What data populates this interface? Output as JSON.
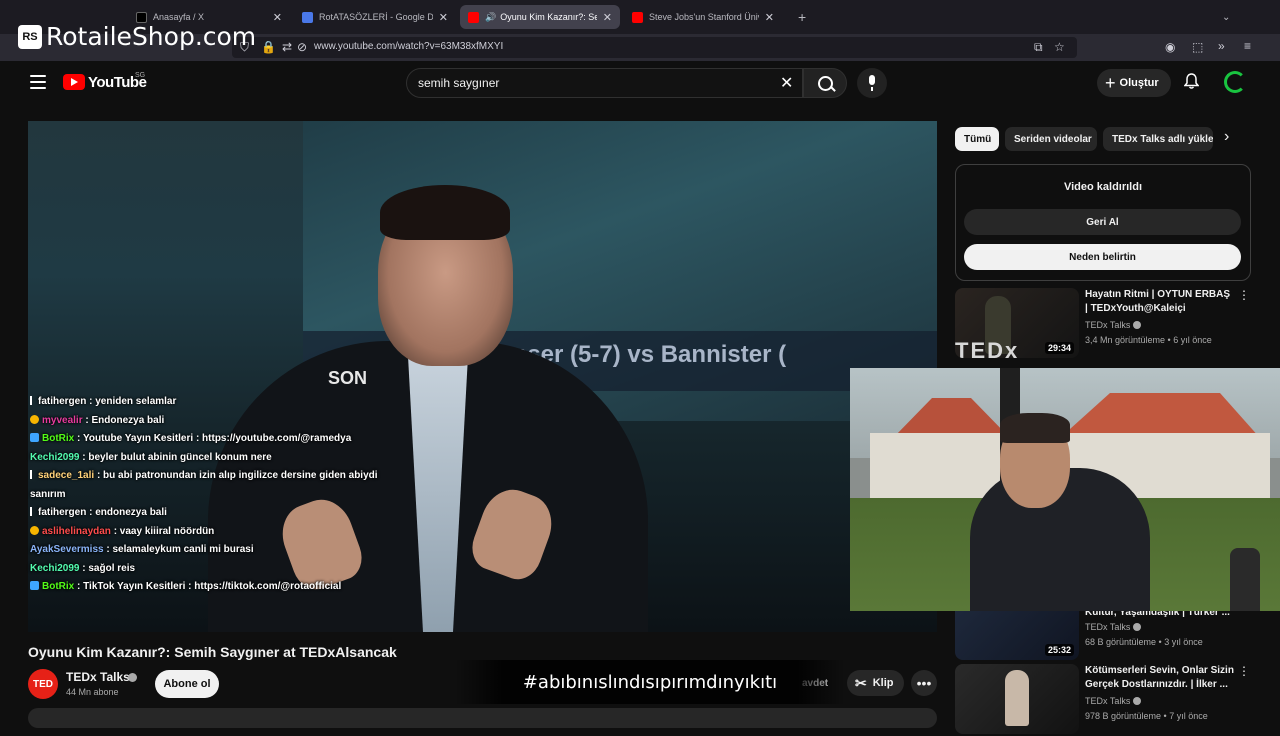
{
  "watermark": {
    "logo": "RS",
    "text": "RotaileShop.com"
  },
  "browser": {
    "tabs": [
      {
        "title": "Anasayfa / X",
        "favicon_color": "#000000"
      },
      {
        "title": "RotATASÖZLERİ - Google Dokü",
        "favicon_color": "#4a78e8"
      },
      {
        "title": "Oyunu Kim Kazanır?: Semih",
        "favicon_color": "#ff0000"
      },
      {
        "title": "Steve Jobs'un Stanford Üniversi",
        "favicon_color": "#ff0000"
      }
    ],
    "url": "www.youtube.com/watch?v=63M38xfMXYI"
  },
  "header": {
    "logo_text": "YouTube",
    "region": "SG",
    "search_value": "semih saygıner",
    "create_label": "Oluştur"
  },
  "video": {
    "slide_text": "onser (5-7) vs Bannister (",
    "on_screen_text": "SON",
    "title": "Oyunu Kim Kazanır?: Semih Saygıner at TEDxAlsancak",
    "channel": {
      "avatar_text": "TED",
      "name": "TEDx Talks",
      "subscribers": "44 Mn abone"
    },
    "subscribe_label": "Abone ol",
    "save_label_partial": "avdet",
    "clip_label": "Klip",
    "more_label": "•••"
  },
  "overlay_hashtag": "#abıbınıslındısıpırımdınyıkıtı",
  "chat": [
    {
      "user": "fatihergen",
      "text": ": yeniden selamlar",
      "color": "#ffffff",
      "badge": "arrow"
    },
    {
      "user": "myvealir",
      "text": ": Endonezya bali",
      "color": "#e73c9f",
      "badge": "coin"
    },
    {
      "user": "BotRix",
      "text": ": Youtube Yayın Kesitleri : https://youtube.com/@ramedya",
      "color": "#53fc18",
      "badge": "bot"
    },
    {
      "user": "Kechi2099",
      "text": ": beyler bulut abinin güncel konum nere",
      "color": "#53fcb0",
      "badge": ""
    },
    {
      "user": "sadece_1ali",
      "text": ": bu abi patronundan izin alıp ingilizce dersine giden abiydi sanırım",
      "color": "#ffd27a",
      "badge": "arrow"
    },
    {
      "user": "fatihergen",
      "text": ": endonezya bali",
      "color": "#ffffff",
      "badge": "arrow"
    },
    {
      "user": "aslihelinaydan",
      "text": ": vaay kiiiral nöördün",
      "color": "#ff4d4d",
      "badge": "coin"
    },
    {
      "user": "AyakSevermiss",
      "text": ": selamaleykum canli mi burasi",
      "color": "#8ab4f8",
      "badge": ""
    },
    {
      "user": "Kechi2099",
      "text": ": sağol reis",
      "color": "#53fcb0",
      "badge": ""
    },
    {
      "user": "BotRix",
      "text": ": TikTok Yayın Kesitleri : https://tiktok.com/@rotaofficial",
      "color": "#53fc18",
      "badge": "bot"
    }
  ],
  "sidebar": {
    "chips": [
      "Tümü",
      "Seriden videolar",
      "TEDx Talks adlı yükle"
    ],
    "removed": {
      "title": "Video kaldırıldı",
      "undo_label": "Geri Al",
      "why_label": "Neden belirtin"
    },
    "recs": [
      {
        "title": "Hayatın Ritmi | OYTUN ERBAŞ | TEDxYouth@Kaleiçi",
        "channel": "TEDx Talks",
        "meta": "3,4 Mn görüntüleme • 6 yıl önce",
        "duration": "29:34"
      },
      {
        "title": "Kültür, Yaşamdaşlık | Türker ...",
        "channel": "TEDx Talks",
        "meta": "68 B görüntüleme • 3 yıl önce",
        "duration": "25:32"
      },
      {
        "title": "Kötümserleri Sevin, Onlar Sizin Gerçek Dostlarınızdır. | İlker ...",
        "channel": "TEDx Talks",
        "meta": "978 B görüntüleme • 7 yıl önce",
        "duration": ""
      }
    ]
  },
  "colors": {
    "yt_red": "#ff0000",
    "bg": "#0f0f0f",
    "accent_green": "#19c440"
  }
}
